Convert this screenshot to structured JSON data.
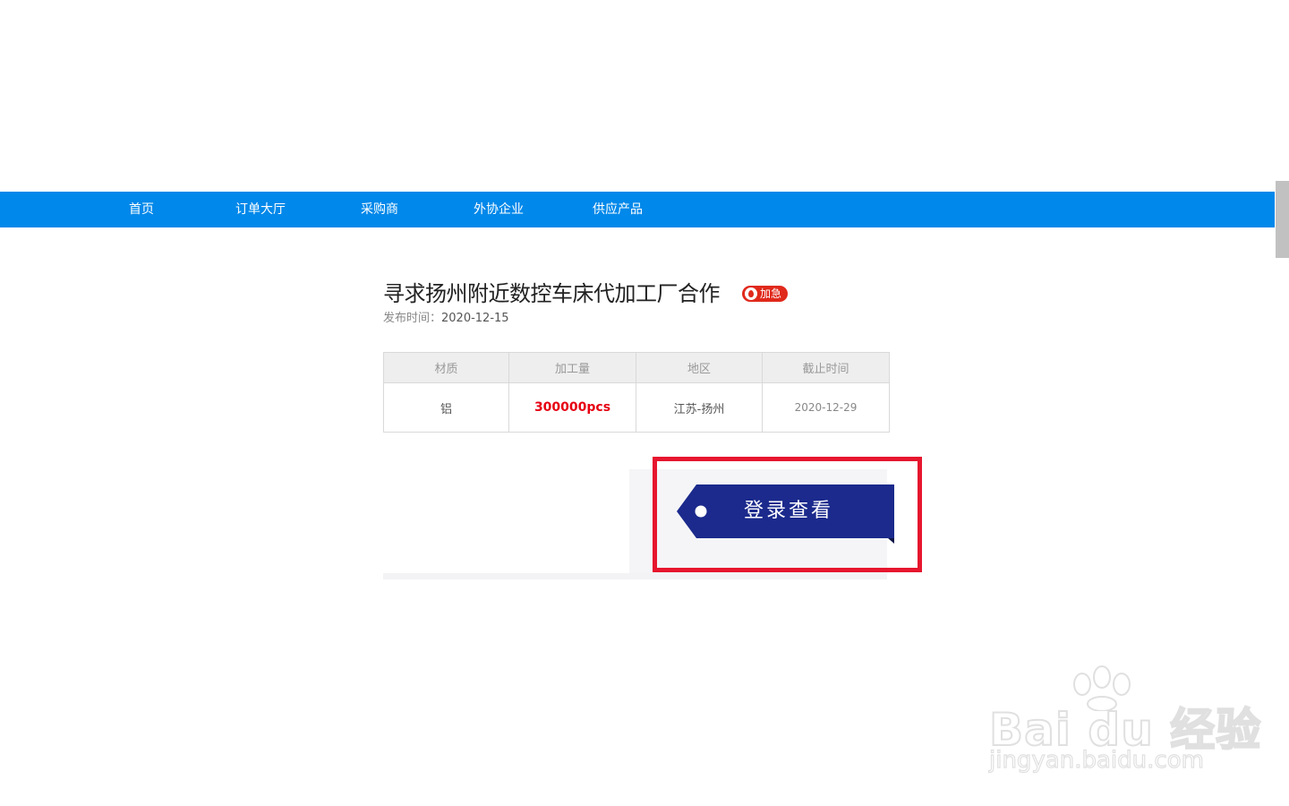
{
  "nav": {
    "items": [
      {
        "label": "首页"
      },
      {
        "label": "订单大厅"
      },
      {
        "label": "采购商"
      },
      {
        "label": "外协企业"
      },
      {
        "label": "供应产品"
      }
    ],
    "background": "#0088ea"
  },
  "order": {
    "title": "寻求扬州附近数控车床代加工厂合作",
    "badge": "加急",
    "publish_label": "发布时间：",
    "publish_date": "2020-12-15"
  },
  "table": {
    "headers": [
      "材质",
      "加工量",
      "地区",
      "截止时间"
    ],
    "row": [
      "铝",
      "300000pcs",
      "江苏-扬州",
      "2020-12-29"
    ]
  },
  "login": {
    "label": "登录查看",
    "color": "#1b2a8c"
  },
  "colors": {
    "highlight": "#e6162e",
    "urgent": "#e0291b",
    "quantity": "#e60012"
  },
  "watermark": {
    "brand": "Bai  du 经验",
    "url": "jingyan.baidu.com"
  }
}
